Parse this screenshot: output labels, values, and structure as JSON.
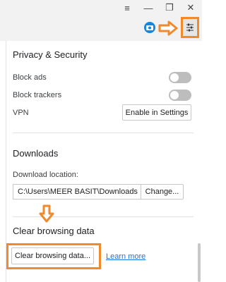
{
  "window": {
    "menu_glyph": "≡",
    "minimize_glyph": "—",
    "maximize_glyph": "❐",
    "close_glyph": "✕"
  },
  "toolbar": {
    "camera_icon": "camera-icon",
    "settings_icon": "easy-setup-icon"
  },
  "privacy": {
    "title": "Privacy & Security",
    "block_ads_label": "Block ads",
    "block_ads_on": false,
    "block_trackers_label": "Block trackers",
    "block_trackers_on": false,
    "vpn_label": "VPN",
    "vpn_button": "Enable in Settings"
  },
  "downloads": {
    "title": "Downloads",
    "location_label": "Download location:",
    "location_value": "C:\\Users\\MEER BASIT\\Downloads",
    "change_button": "Change..."
  },
  "clear": {
    "title": "Clear browsing data",
    "button": "Clear browsing data...",
    "learn_more": "Learn more"
  },
  "annotation_color": "#f08a2c"
}
